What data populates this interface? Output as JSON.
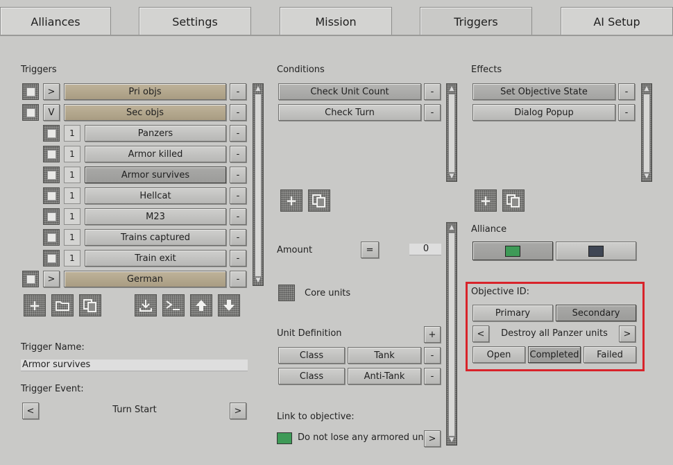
{
  "tabs": [
    "Alliances",
    "Settings",
    "Mission",
    "Triggers",
    "AI Setup"
  ],
  "active_tab": "Triggers",
  "triggers": {
    "title": "Triggers",
    "items": [
      {
        "expand": ">",
        "num": "",
        "label": "Pri objs",
        "tan": true
      },
      {
        "expand": "V",
        "num": "",
        "label": "Sec objs",
        "tan": true
      },
      {
        "expand": "",
        "num": "1",
        "label": "Panzers"
      },
      {
        "expand": "",
        "num": "1",
        "label": "Armor killed"
      },
      {
        "expand": "",
        "num": "1",
        "label": "Armor survives"
      },
      {
        "expand": "",
        "num": "1",
        "label": "Hellcat"
      },
      {
        "expand": "",
        "num": "1",
        "label": "M23"
      },
      {
        "expand": "",
        "num": "1",
        "label": "Trains captured"
      },
      {
        "expand": "",
        "num": "1",
        "label": "Train exit"
      },
      {
        "expand": ">",
        "num": "",
        "label": "German",
        "tan": true
      }
    ],
    "remove_label": "-"
  },
  "trigger_name": {
    "label": "Trigger Name:",
    "value": "Armor survives"
  },
  "trigger_event": {
    "label": "Trigger Event:",
    "value": "Turn Start",
    "prev": "<",
    "next": ">"
  },
  "conditions": {
    "title": "Conditions",
    "items": [
      "Check Unit Count",
      "Check Turn"
    ],
    "remove_label": "-"
  },
  "amount": {
    "label": "Amount",
    "op": "=",
    "value": "0"
  },
  "core_units": {
    "label": "Core units"
  },
  "unit_definition": {
    "label": "Unit Definition",
    "add": "+",
    "rows": [
      [
        "Class",
        "Tank"
      ],
      [
        "Class",
        "Anti-Tank"
      ]
    ],
    "remove_label": "-"
  },
  "link_to_objective": {
    "label": "Link to objective:",
    "value": "Do not lose any armored units",
    "next": ">"
  },
  "effects": {
    "title": "Effects",
    "items": [
      "Set Objective State",
      "Dialog Popup"
    ],
    "remove_label": "-"
  },
  "alliance": {
    "label": "Alliance",
    "colors": [
      "#3e9a57",
      "#3f4654"
    ]
  },
  "objective": {
    "label": "Objective ID:",
    "types": [
      "Primary",
      "Secondary"
    ],
    "selected_type": "Secondary",
    "prev": "<",
    "next": ">",
    "value": "Destroy all Panzer units",
    "states": [
      "Open",
      "Completed",
      "Failed"
    ],
    "selected_state": "Completed"
  },
  "colors": {
    "highlight": "#d8232a",
    "link_swatch": "#3e9a57"
  }
}
